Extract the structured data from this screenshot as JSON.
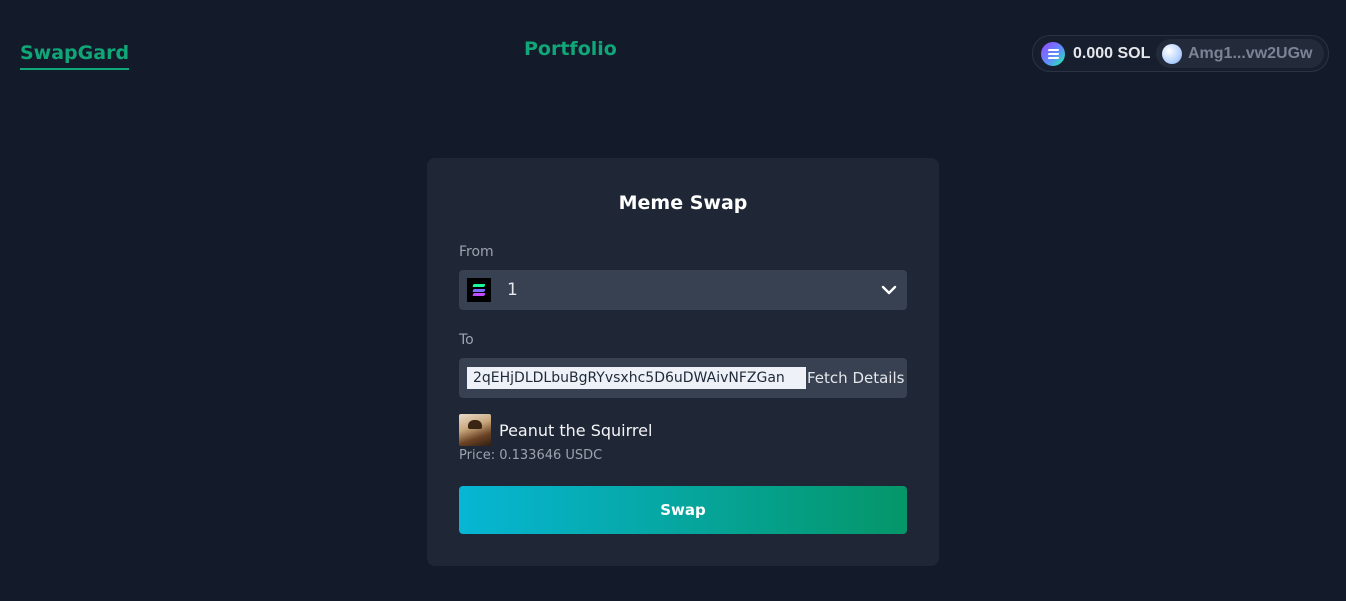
{
  "nav": {
    "brand": "SwapGard",
    "portfolio": "Portfolio"
  },
  "wallet": {
    "balance": "0.000 SOL",
    "address": "Amg1...vw2UGw"
  },
  "card": {
    "title": "Meme Swap",
    "from_label": "From",
    "from_value": "1",
    "to_label": "To",
    "to_value": "2qEHjDLDLbuBgRYvsxhc5D6uDWAivNFZGan",
    "fetch_label": "Fetch Details",
    "token_name": "Peanut the Squirrel",
    "price_text": "Price: 0.133646 USDC",
    "swap_label": "Swap"
  },
  "colors": {
    "accent": "#10a678",
    "background": "#131a2a",
    "card": "#1f2737",
    "swap_gradient_start": "#06b6d4",
    "swap_gradient_end": "#059669"
  },
  "icons": {
    "wallet_token": "solana-icon",
    "from_token": "solana-icon",
    "dropdown": "chevron-down-icon",
    "avatar": "wallet-avatar-icon"
  }
}
